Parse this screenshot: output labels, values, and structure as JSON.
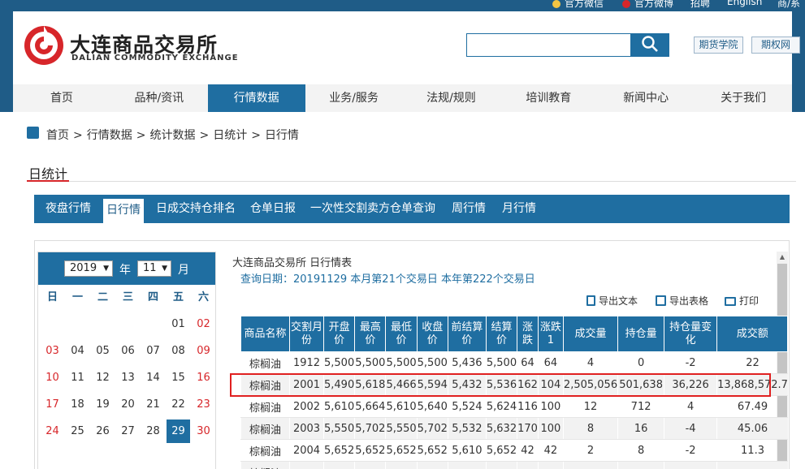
{
  "top_links": [
    {
      "label": "官方微信",
      "icon": "wechat-icon"
    },
    {
      "label": "官方微博",
      "icon": "weibo-icon"
    },
    {
      "label": "招聘",
      "icon": ""
    },
    {
      "label": "English",
      "icon": ""
    },
    {
      "label": "商/系",
      "icon": ""
    }
  ],
  "brand": {
    "name_cn": "大连商品交易所",
    "name_en": "DALIAN COMMODITY EXCHANGE"
  },
  "search": {
    "placeholder": "",
    "value": ""
  },
  "header_links": [
    "期货学院",
    "期权网"
  ],
  "nav": [
    "首页",
    "品种/资讯",
    "行情数据",
    "业务/服务",
    "法规/规则",
    "培训教育",
    "新闻中心",
    "关于我们"
  ],
  "nav_active": "行情数据",
  "breadcrumb": [
    "首页",
    "行情数据",
    "统计数据",
    "日统计",
    "日行情"
  ],
  "section_title": "日统计",
  "tabs": [
    "夜盘行情",
    "日行情",
    "日成交持仓排名",
    "仓单日报",
    "一次性交割卖方仓单查询",
    "周行情",
    "月行情"
  ],
  "tab_active": "日行情",
  "calendar": {
    "year": "2019",
    "year_label": "年",
    "month": "11",
    "month_label": "月",
    "weekdays": [
      "日",
      "一",
      "二",
      "三",
      "四",
      "五",
      "六"
    ],
    "weeks": [
      [
        "",
        "",
        "",
        "",
        "",
        "01",
        "02"
      ],
      [
        "03",
        "04",
        "05",
        "06",
        "07",
        "08",
        "09"
      ],
      [
        "10",
        "11",
        "12",
        "13",
        "14",
        "15",
        "16"
      ],
      [
        "17",
        "18",
        "19",
        "20",
        "21",
        "22",
        "23"
      ],
      [
        "24",
        "25",
        "26",
        "27",
        "28",
        "29",
        "30"
      ]
    ],
    "selected_day": "29"
  },
  "report": {
    "title": "大连商品交易所 日行情表",
    "query": "查询日期：20191129 本月第21个交易日 本年第222个交易日",
    "export_text": "导出文本",
    "export_table": "导出表格",
    "print": "打印"
  },
  "table": {
    "headers": [
      "商品名称",
      "交割月份",
      "开盘价",
      "最高价",
      "最低价",
      "收盘价",
      "前结算价",
      "结算价",
      "涨跌",
      "涨跌1",
      "成交量",
      "持仓量",
      "持仓量变化",
      "成交额"
    ],
    "rows": [
      [
        "棕榈油",
        "1912",
        "5,500",
        "5,500",
        "5,500",
        "5,500",
        "5,436",
        "5,500",
        "64",
        "64",
        "4",
        "0",
        "-2",
        "22"
      ],
      [
        "棕榈油",
        "2001",
        "5,490",
        "5,618",
        "5,466",
        "5,594",
        "5,432",
        "5,536",
        "162",
        "104",
        "2,505,056",
        "501,638",
        "36,226",
        "13,868,572.7"
      ],
      [
        "棕榈油",
        "2002",
        "5,610",
        "5,664",
        "5,610",
        "5,640",
        "5,524",
        "5,624",
        "116",
        "100",
        "12",
        "712",
        "4",
        "67.49"
      ],
      [
        "棕榈油",
        "2003",
        "5,550",
        "5,702",
        "5,550",
        "5,702",
        "5,532",
        "5,632",
        "170",
        "100",
        "8",
        "16",
        "-4",
        "45.06"
      ],
      [
        "棕榈油",
        "2004",
        "5,652",
        "5,652",
        "5,652",
        "5,652",
        "5,610",
        "5,652",
        "42",
        "42",
        "2",
        "8",
        "-2",
        "11.3"
      ],
      [
        "棕榈油",
        "",
        "",
        "",
        "",
        "",
        "",
        "",
        "",
        "",
        "",
        "",
        "",
        ""
      ]
    ],
    "highlighted_row": 1
  },
  "colors": {
    "primary": "#1f6ea1",
    "dark": "#1f5c87",
    "accent_red": "#d7262a",
    "highlight_box": "#e02020"
  }
}
